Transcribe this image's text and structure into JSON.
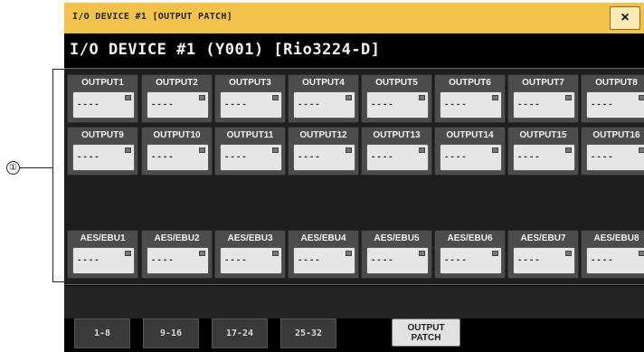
{
  "window": {
    "title": "I/O DEVICE #1 [OUTPUT PATCH]",
    "close_icon": "×",
    "device_title": "I/O DEVICE #1 (Y001) [Rio3224-D]"
  },
  "ports_row1": [
    {
      "label": "OUTPUT1",
      "value": "----"
    },
    {
      "label": "OUTPUT2",
      "value": "----"
    },
    {
      "label": "OUTPUT3",
      "value": "----"
    },
    {
      "label": "OUTPUT4",
      "value": "----"
    },
    {
      "label": "OUTPUT5",
      "value": "----"
    },
    {
      "label": "OUTPUT6",
      "value": "----"
    },
    {
      "label": "OUTPUT7",
      "value": "----"
    },
    {
      "label": "OUTPUT8",
      "value": "----"
    }
  ],
  "ports_row2": [
    {
      "label": "OUTPUT9",
      "value": "----"
    },
    {
      "label": "OUTPUT10",
      "value": "----"
    },
    {
      "label": "OUTPUT11",
      "value": "----"
    },
    {
      "label": "OUTPUT12",
      "value": "----"
    },
    {
      "label": "OUTPUT13",
      "value": "----"
    },
    {
      "label": "OUTPUT14",
      "value": "----"
    },
    {
      "label": "OUTPUT15",
      "value": "----"
    },
    {
      "label": "OUTPUT16",
      "value": "----"
    }
  ],
  "ports_row3": [
    {
      "label": "AES/EBU1",
      "value": "----"
    },
    {
      "label": "AES/EBU2",
      "value": "----"
    },
    {
      "label": "AES/EBU3",
      "value": "----"
    },
    {
      "label": "AES/EBU4",
      "value": "----"
    },
    {
      "label": "AES/EBU5",
      "value": "----"
    },
    {
      "label": "AES/EBU6",
      "value": "----"
    },
    {
      "label": "AES/EBU7",
      "value": "----"
    },
    {
      "label": "AES/EBU8",
      "value": "----"
    }
  ],
  "tabs": [
    "1-8",
    "9-16",
    "17-24",
    "25-32"
  ],
  "patch_button": {
    "line1": "OUTPUT",
    "line2": "PATCH"
  },
  "callout": "①",
  "colors": {
    "title_bar": "#f2c24a",
    "port_button": "#e6e6e6",
    "background": "#000000"
  }
}
